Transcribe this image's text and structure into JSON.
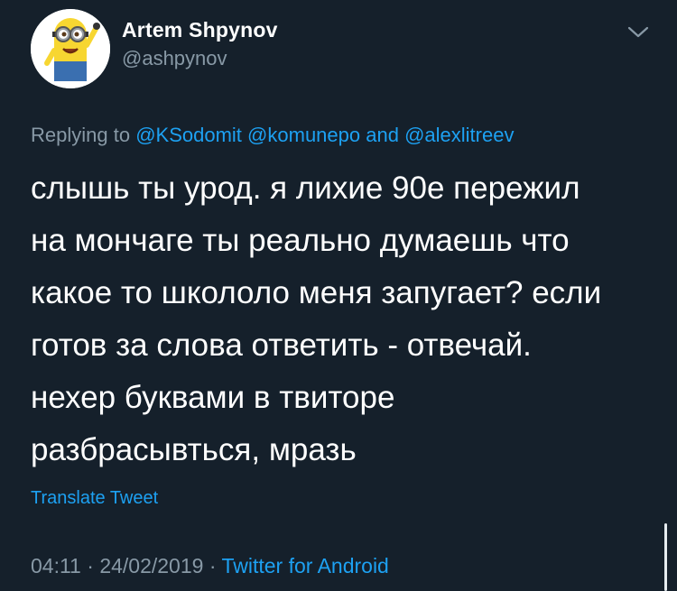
{
  "author": {
    "display_name": "Artem Shpynov",
    "handle": "@ashpynov",
    "avatar_icon": "minion-avatar-icon"
  },
  "menu": {
    "icon": "chevron-down-icon"
  },
  "reply": {
    "prefix": "Replying to",
    "mentions": [
      "@KSodomit",
      "@komunepo"
    ],
    "conjunction": "and",
    "last_mention": "@alexlitreev"
  },
  "tweet": {
    "lines": [
      "слышь ты урод. я лихие 90е пережил",
      "на мончаге ты реально думаешь что",
      "какое то школоло меня запугает? если",
      "готов за слова ответить - отвечай.",
      "нехер буквами в твиторе",
      "разбрасывться, мразь"
    ]
  },
  "translate_label": "Translate Tweet",
  "meta": {
    "time": "04:11",
    "separator": "·",
    "date": "24/02/2019",
    "source": "Twitter for Android"
  },
  "colors": {
    "background": "#15202b",
    "accent": "#1da1f2",
    "secondary_text": "#8899a6",
    "primary_text": "#ffffff"
  }
}
